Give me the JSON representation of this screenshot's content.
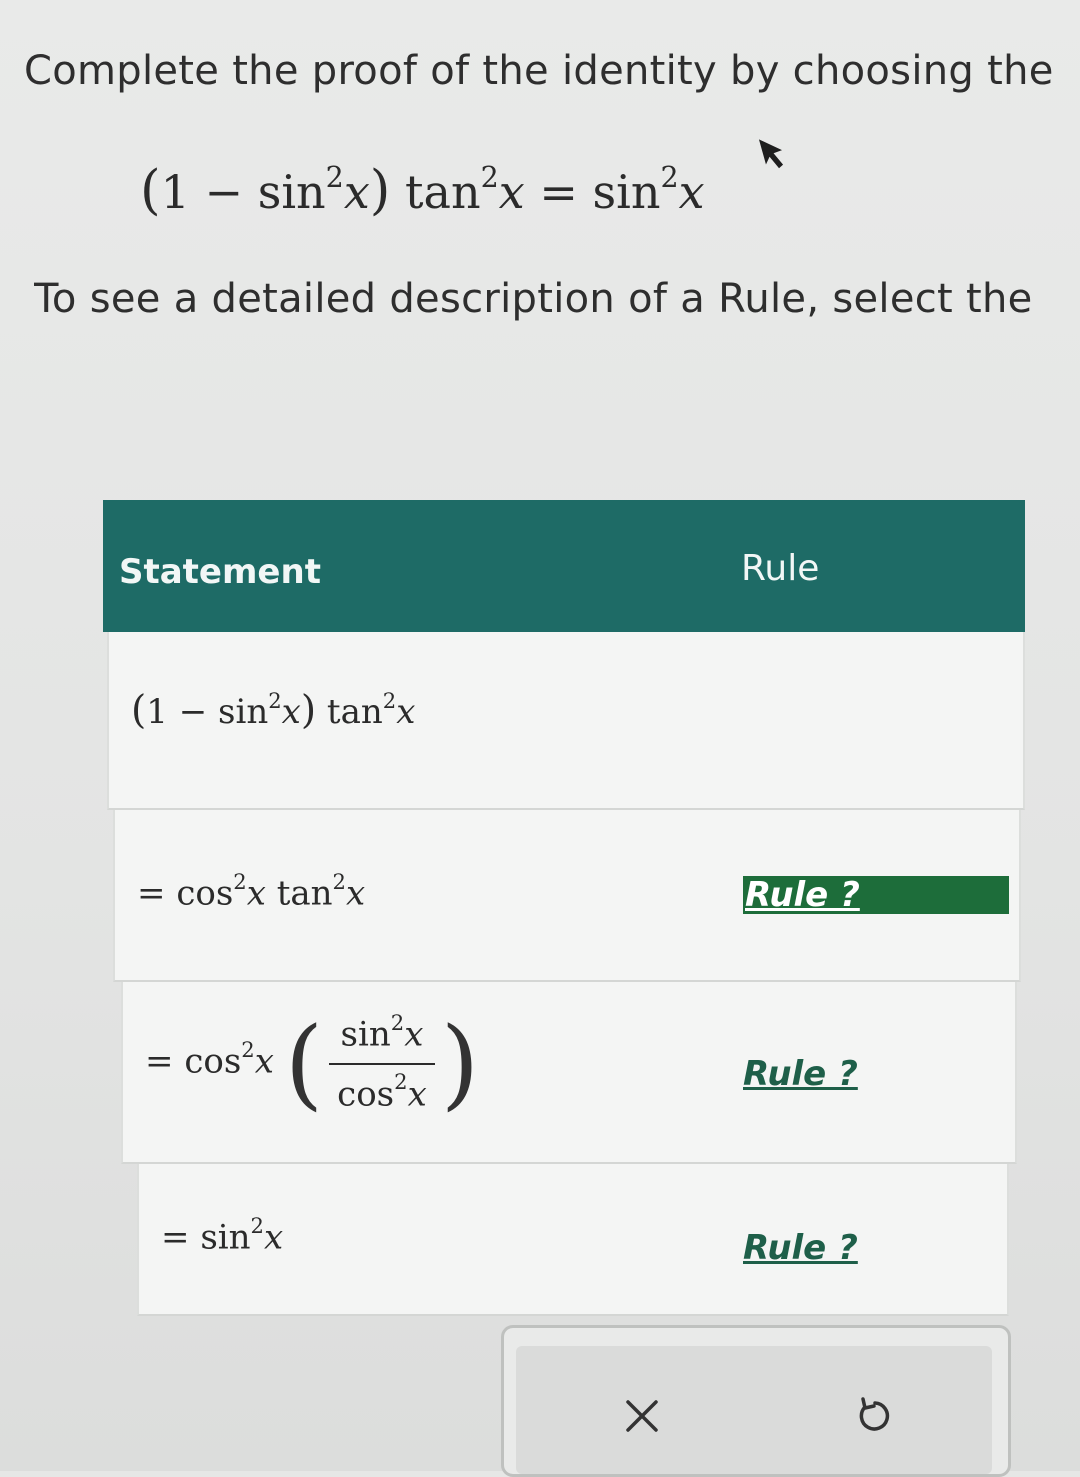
{
  "instruction": "Complete the proof of the identity by choosing the",
  "rule_hint": "To see a detailed description of a Rule, select the",
  "identity": {
    "lhs_open": "(1 − sin",
    "exp": "2",
    "x": "x",
    "rhs_mid": ") tan",
    "eq": "= sin"
  },
  "table": {
    "headers": {
      "statement": "Statement",
      "rule": "Rule"
    },
    "rows": [
      {
        "statement": "(1 − sin²x) tan²x",
        "rule": ""
      },
      {
        "statement": "= cos²x tan²x",
        "rule": "Rule ?"
      },
      {
        "statement": "= cos²x (sin²x / cos²x)",
        "rule": "Rule ?"
      },
      {
        "statement": "= sin²x",
        "rule": "Rule ?"
      }
    ]
  },
  "math_parts": {
    "one": "1",
    "minus": "−",
    "sin": "sin",
    "cos": "cos",
    "tan": "tan",
    "two": "2",
    "x": "x",
    "equals": "="
  },
  "toolbar": {
    "clear_icon": "close-icon",
    "reset_icon": "undo-icon"
  }
}
